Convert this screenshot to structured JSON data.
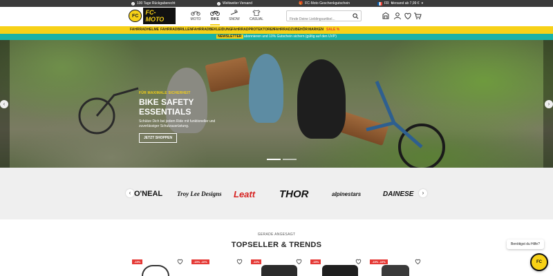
{
  "topbar": {
    "shipping_returns": "100 Tage Rückgaberecht",
    "worldwide": "Weltweiter Versand",
    "voucher": "FC-Moto Geschenkgutschein",
    "country_code": "FR",
    "free_shipping": "Versand ab 7,99 €"
  },
  "header": {
    "logo_badge": "FC",
    "logo_text": "FC-MOTO",
    "categories": [
      {
        "label": "MOTO",
        "icon": "motorbike-icon"
      },
      {
        "label": "BIKE",
        "icon": "bicycle-icon"
      },
      {
        "label": "SNOW",
        "icon": "snow-icon"
      },
      {
        "label": "CASUAL",
        "icon": "shirt-icon"
      }
    ],
    "active_category": "BIKE",
    "search_placeholder": "Finde Deine Lieblingsartikel..."
  },
  "catnav": {
    "items": [
      "FAHRRADHELME",
      "FAHRRADBRILLEN",
      "FAHRRADBEKLEIDUNG",
      "FAHRRADPROTEKTOREN",
      "FAHRRADZUBEHÖR",
      "MARKEN",
      "SALE %"
    ]
  },
  "promo": {
    "badge": "NEWSLETTER",
    "text": "abonnieren und 10% Gutschein sichern (gültig auf den UVP)"
  },
  "hero": {
    "kicker": "FÜR MAXIMALE SICHERHEIT",
    "title": "BIKE SAFETY ESSENTIALS",
    "subtitle": "Schütze Dich bei jedem Ride mit funktioneller und zuverlässiger Schutzausrüstung.",
    "cta": "JETZT SHOPPEN",
    "slides_total": 2,
    "active_slide": 1
  },
  "brands": [
    "O'NEAL",
    "Troy Lee Designs",
    "Leatt",
    "THOR",
    "alpinestars",
    "DAINESE"
  ],
  "topseller": {
    "kicker": "GERADE ANGESAGT",
    "heading": "TOPSELLER & TRENDS",
    "badges": [
      "-15%",
      "-15% -10%",
      "-10%",
      "-15%",
      "-15% -10%"
    ]
  },
  "help": {
    "bubble": "Benötigst du Hilfe?"
  },
  "colors": {
    "brand_yellow": "#f7d117",
    "promo_teal": "#19b2a6",
    "sale_red": "#e53935",
    "topbar_dark": "#3a3a3a"
  }
}
